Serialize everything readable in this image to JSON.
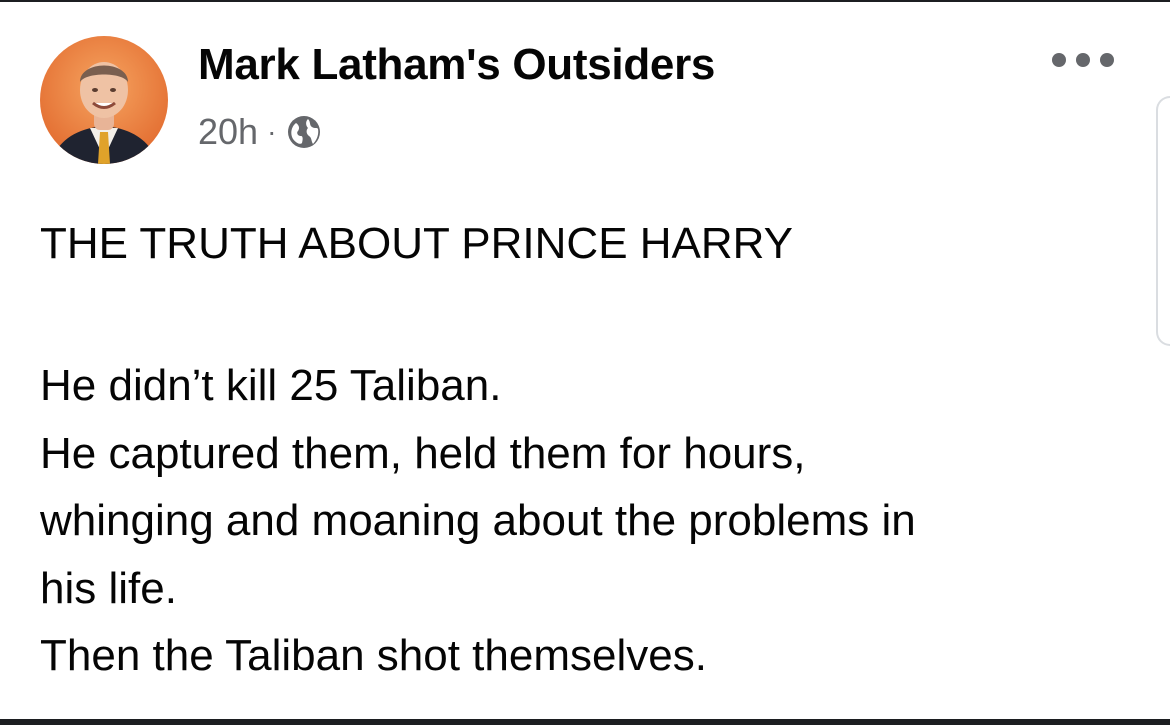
{
  "post": {
    "page_name": "Mark Latham's Outsiders",
    "timestamp": "20h",
    "separator": "·",
    "privacy_icon": "globe-icon",
    "more_icon": "more-options-icon",
    "headline": "THE TRUTH ABOUT PRINCE HARRY",
    "body_lines": [
      "He didn’t kill 25 Taliban.",
      "He captured them, held them for hours,",
      "whinging and moaning about the problems in",
      "his life.",
      "Then the Taliban shot themselves."
    ]
  },
  "colors": {
    "text_primary": "#050505",
    "text_secondary": "#65676b",
    "background": "#ffffff",
    "avatar_background": "#e8733a"
  }
}
